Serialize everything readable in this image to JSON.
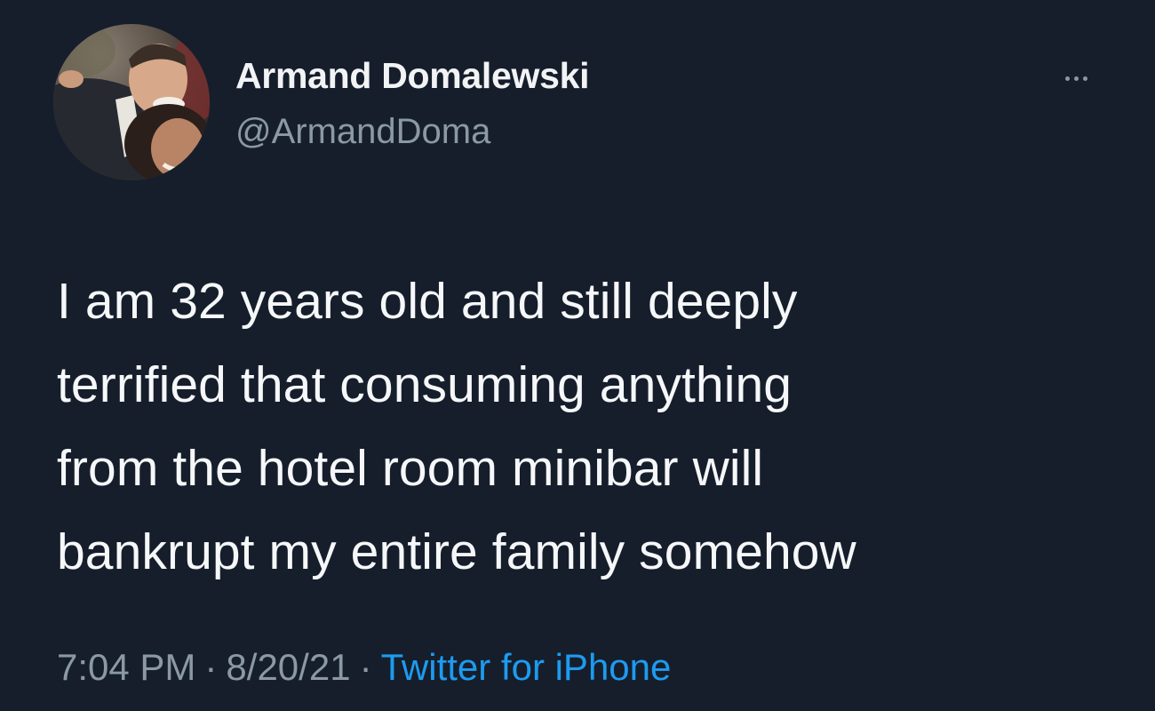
{
  "tweet": {
    "author_name": "Armand Domalewski",
    "author_handle": "@ArmandDoma",
    "text": "I am 32 years old and still deeply\nterrified that consuming anything\nfrom the hotel room minibar will\nbankrupt my entire family somehow",
    "time": "7:04 PM",
    "date": "8/20/21",
    "separator": "·",
    "source": "Twitter for iPhone"
  },
  "icons": {
    "more": "more-horizontal-icon",
    "avatar": "avatar-photo"
  },
  "colors": {
    "background": "#161e2b",
    "primary_text": "#f5f7f9",
    "secondary_text": "#8b98a5",
    "link": "#1d9bf0"
  }
}
